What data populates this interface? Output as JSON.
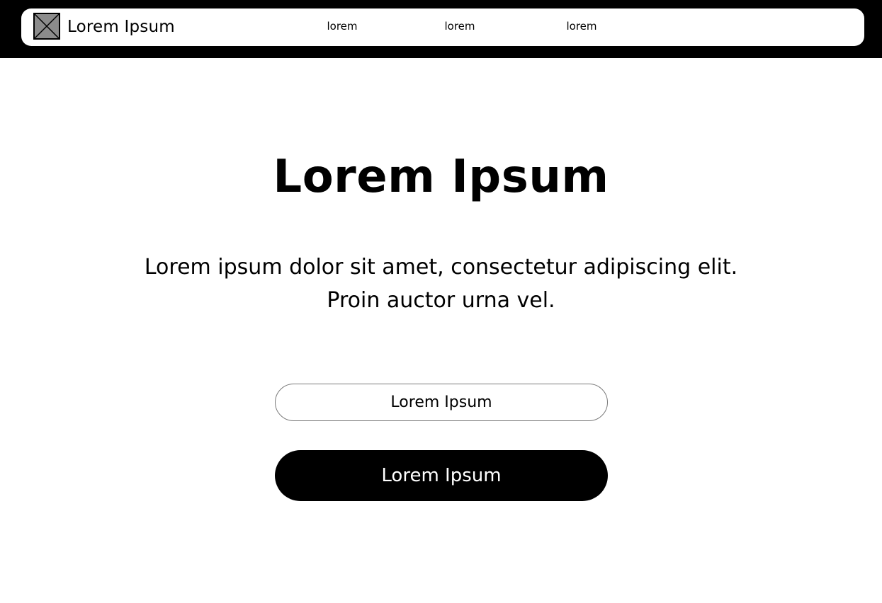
{
  "header": {
    "brand_name": "Lorem Ipsum",
    "logo_icon": "image-placeholder-icon",
    "nav_links": [
      "lorem",
      "lorem",
      "lorem"
    ]
  },
  "hero": {
    "title": "Lorem Ipsum",
    "description": "Lorem ipsum dolor sit amet, consectetur adipiscing elit. Proin auctor urna vel.",
    "input_placeholder": "Lorem Ipsum",
    "button_label": "Lorem Ipsum"
  },
  "colors": {
    "header_background": "#000000",
    "navbar_background": "#ffffff",
    "button_background": "#000000",
    "button_text": "#ffffff",
    "logo_fill": "#8c8c8c"
  }
}
